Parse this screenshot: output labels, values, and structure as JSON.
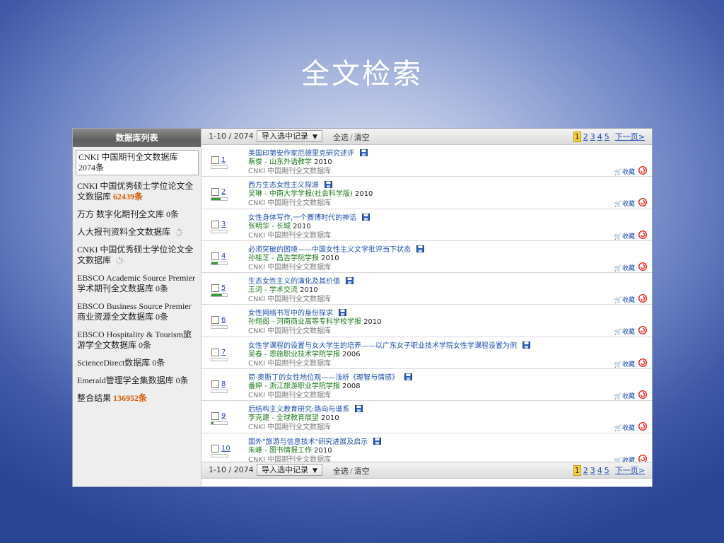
{
  "slide": {
    "title": "全文检索"
  },
  "sidebar": {
    "header": "数据库列表",
    "items": [
      {
        "name": "CNKI 中国期刊全文数据库",
        "count": "2074条",
        "style": "plain"
      },
      {
        "name": "CNKI 中国优秀硕士学位论文全文数据库",
        "count": "62439条",
        "style": "red"
      },
      {
        "name": "万方 数字化期刊全文库",
        "count": "0条",
        "style": "plain"
      },
      {
        "name": "人大报刊资料全文数据库",
        "count": "",
        "style": "loading"
      },
      {
        "name": "CNKI 中国优秀硕士学位论文全文数据库",
        "count": "",
        "style": "loading"
      },
      {
        "name": "EBSCO Academic Source Premier 学术期刊全文数据库",
        "count": "0条",
        "style": "plain"
      },
      {
        "name": "EBSCO Business Source Premier 商业资源全文数据库",
        "count": "0条",
        "style": "plain"
      },
      {
        "name": "EBSCO Hospitality & Tourism旅游学全文数据库",
        "count": "0条",
        "style": "plain"
      },
      {
        "name": "ScienceDirect数据库",
        "count": "0条",
        "style": "plain"
      },
      {
        "name": "Emerald管理学全集数据库",
        "count": "0条",
        "style": "plain"
      },
      {
        "name": "整合结果",
        "count": "136952条",
        "style": "red"
      }
    ]
  },
  "toolbar": {
    "range": "1-10",
    "total": "2074",
    "import_label": "导入选中记录",
    "select_all": "全选",
    "clear": "清空",
    "pages": [
      "1",
      "2",
      "3",
      "4",
      "5"
    ],
    "current_page": "1",
    "next_label": "下一页>"
  },
  "results": [
    {
      "num": "1",
      "title": "美国印第安作家厄德里克研究述评",
      "author": "蔡俊",
      "journal": "山东外语教学",
      "year": "2010",
      "source": "CNKI 中国期刊全文数据库",
      "relevance": 0.0
    },
    {
      "num": "2",
      "title": "西方生态女性主义探源",
      "author": "吴琳",
      "journal": "中南大学学报(社会科学版)",
      "year": "2010",
      "source": "CNKI 中国期刊全文数据库",
      "relevance": 0.6
    },
    {
      "num": "3",
      "title": "女性身体写作,一个赛博时代的神话",
      "author": "张明华",
      "journal": "长城",
      "year": "2010",
      "source": "CNKI 中国期刊全文数据库",
      "relevance": 0.0
    },
    {
      "num": "4",
      "title": "必须突破的困境——中国女性主义文学批评当下状态",
      "author": "孙桂芝",
      "journal": "昌吉学院学报",
      "year": "2010",
      "source": "CNKI 中国期刊全文数据库",
      "relevance": 0.4
    },
    {
      "num": "5",
      "title": "生态女性主义的演化及其价值",
      "author": "王词",
      "journal": "学术交流",
      "year": "2010",
      "source": "CNKI 中国期刊全文数据库",
      "relevance": 0.7
    },
    {
      "num": "6",
      "title": "女性网络书写中的身份探求",
      "author": "孙翔阁",
      "journal": "河南商业高等专科学校学报",
      "year": "2010",
      "source": "CNKI 中国期刊全文数据库",
      "relevance": 0.0
    },
    {
      "num": "7",
      "title": "女性学课程的设置与女大学生的培养——以广东女子职业技术学院女性学课程设置为例",
      "author": "吴春",
      "journal": "恩施职业技术学院学报",
      "year": "2006",
      "source": "CNKI 中国期刊全文数据库",
      "relevance": 0.0
    },
    {
      "num": "8",
      "title": "简·奥斯丁的女性地位观——浅析《理智与情感》",
      "author": "番婷",
      "journal": "浙江旅游职业学院学报",
      "year": "2008",
      "source": "CNKI 中国期刊全文数据库",
      "relevance": 0.0
    },
    {
      "num": "9",
      "title": "后结构主义教育研究:路向与谱系",
      "author": "李克建",
      "journal": "全球教育展望",
      "year": "2010",
      "source": "CNKI 中国期刊全文数据库",
      "relevance": 0.15
    },
    {
      "num": "10",
      "title": "国外\"旅游与信息技术\"研究进展及启示",
      "author": "朱峰",
      "journal": "图书情报工作",
      "year": "2010",
      "source": "CNKI 中国期刊全文数据库",
      "relevance": 0.0
    }
  ],
  "fav_label": "收藏",
  "colors": {
    "link": "#1d4fb3",
    "author": "#1f7a1f",
    "count_red": "#d95800",
    "current_page": "#f3d24a"
  }
}
